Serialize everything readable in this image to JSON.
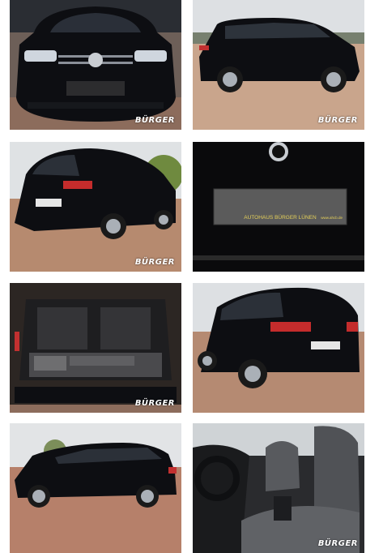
{
  "gallery": {
    "watermark": "BÜRGER",
    "plate_text": "AUTOHAUS BÜRGER LÜNEN",
    "plate_url": "www.ahcb.de",
    "photos": [
      {
        "icon": "car-front-photo"
      },
      {
        "icon": "car-side-photo"
      },
      {
        "icon": "car-rear-three-quarter-photo"
      },
      {
        "icon": "license-plate-closeup-photo"
      },
      {
        "icon": "trunk-interior-photo"
      },
      {
        "icon": "car-rear-right-photo"
      },
      {
        "icon": "car-left-side-photo"
      },
      {
        "icon": "front-seat-interior-photo"
      }
    ]
  },
  "colors": {
    "car": "#0d0e12",
    "paving": "#a07a62",
    "sky": "#d9dde0"
  }
}
